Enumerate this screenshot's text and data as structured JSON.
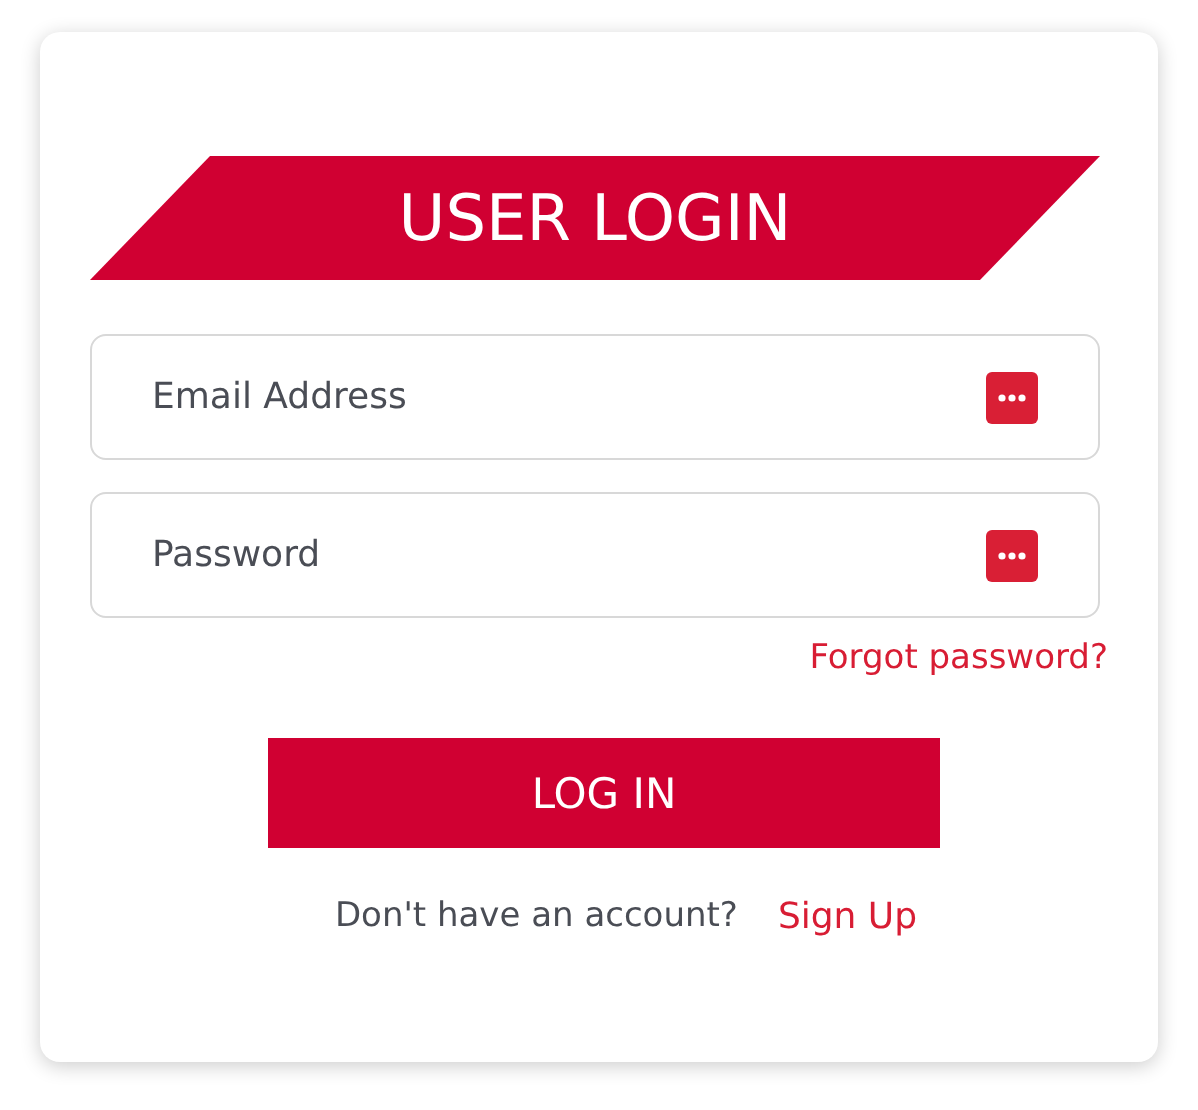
{
  "title": "USER LOGIN",
  "fields": [
    {
      "placeholder": "Email Address"
    },
    {
      "placeholder": "Password"
    }
  ],
  "forgot_link": "Forgot password?",
  "login_button": "LOG IN",
  "signup_prompt": "Don't have an account?",
  "signup_link": "Sign Up"
}
